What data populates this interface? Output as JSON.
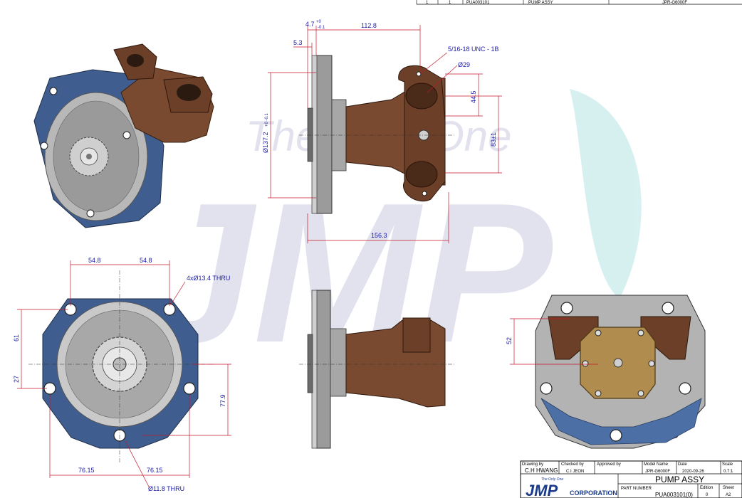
{
  "top_table": {
    "qty1": "1",
    "qty2": "1",
    "part_no": "PUA003101",
    "desc": "PUMP ASSY",
    "model": "JPR-G6000F"
  },
  "watermark": {
    "tagline": "The Only One",
    "logo": "JMP"
  },
  "dims": {
    "d4_7": "4.7",
    "d4_7_tol_top": "+0",
    "d4_7_tol_bot": "-0.1",
    "d112_8": "112.8",
    "d5_3": "5.3",
    "thread": "5/16-18 UNC - 1B",
    "dia29": "Ø29",
    "d44_5": "44.5",
    "d83": "83±1",
    "dia137": "Ø137.2",
    "dia137_tol": "+0 -0.1",
    "d156_3": "156.3",
    "d54_8a": "54.8",
    "d54_8b": "54.8",
    "holes": "4xØ13.4 THRU",
    "d61": "61",
    "d27": "27",
    "d77_9": "77.9",
    "d76_15a": "76.15",
    "d76_15b": "76.15",
    "dia11_8": "Ø11.8 THRU",
    "d52": "52"
  },
  "title_block": {
    "drawing_by_label": "Drawing by",
    "drawing_by": "C.H HWANG",
    "checked_by_label": "Checked by",
    "checked_by": "C.I JEON",
    "approved_by_label": "Approved by",
    "approved_by": "",
    "model_label": "Model Name",
    "model": "JPR-G6000F",
    "date_label": "Date",
    "date": "2020-09-26",
    "scale_label": "Scale",
    "scale": "0.7:1",
    "title": "PUMP ASSY",
    "logo_tagline": "The Only One",
    "logo": "JMP",
    "logo_corp": "CORPORATION",
    "part_number_label": "PART NUMBER",
    "part_number": "PUA003101(0)",
    "edition_label": "Edition",
    "edition": "0",
    "sheet_label": "Sheet",
    "sheet": "A2"
  },
  "colors": {
    "flange_blue": "#3f5e8f",
    "bronze": "#7a4a30",
    "brass_plate": "#b08d4e",
    "dim_text": "#1a1aa8",
    "dim_line": "#c4182a"
  }
}
